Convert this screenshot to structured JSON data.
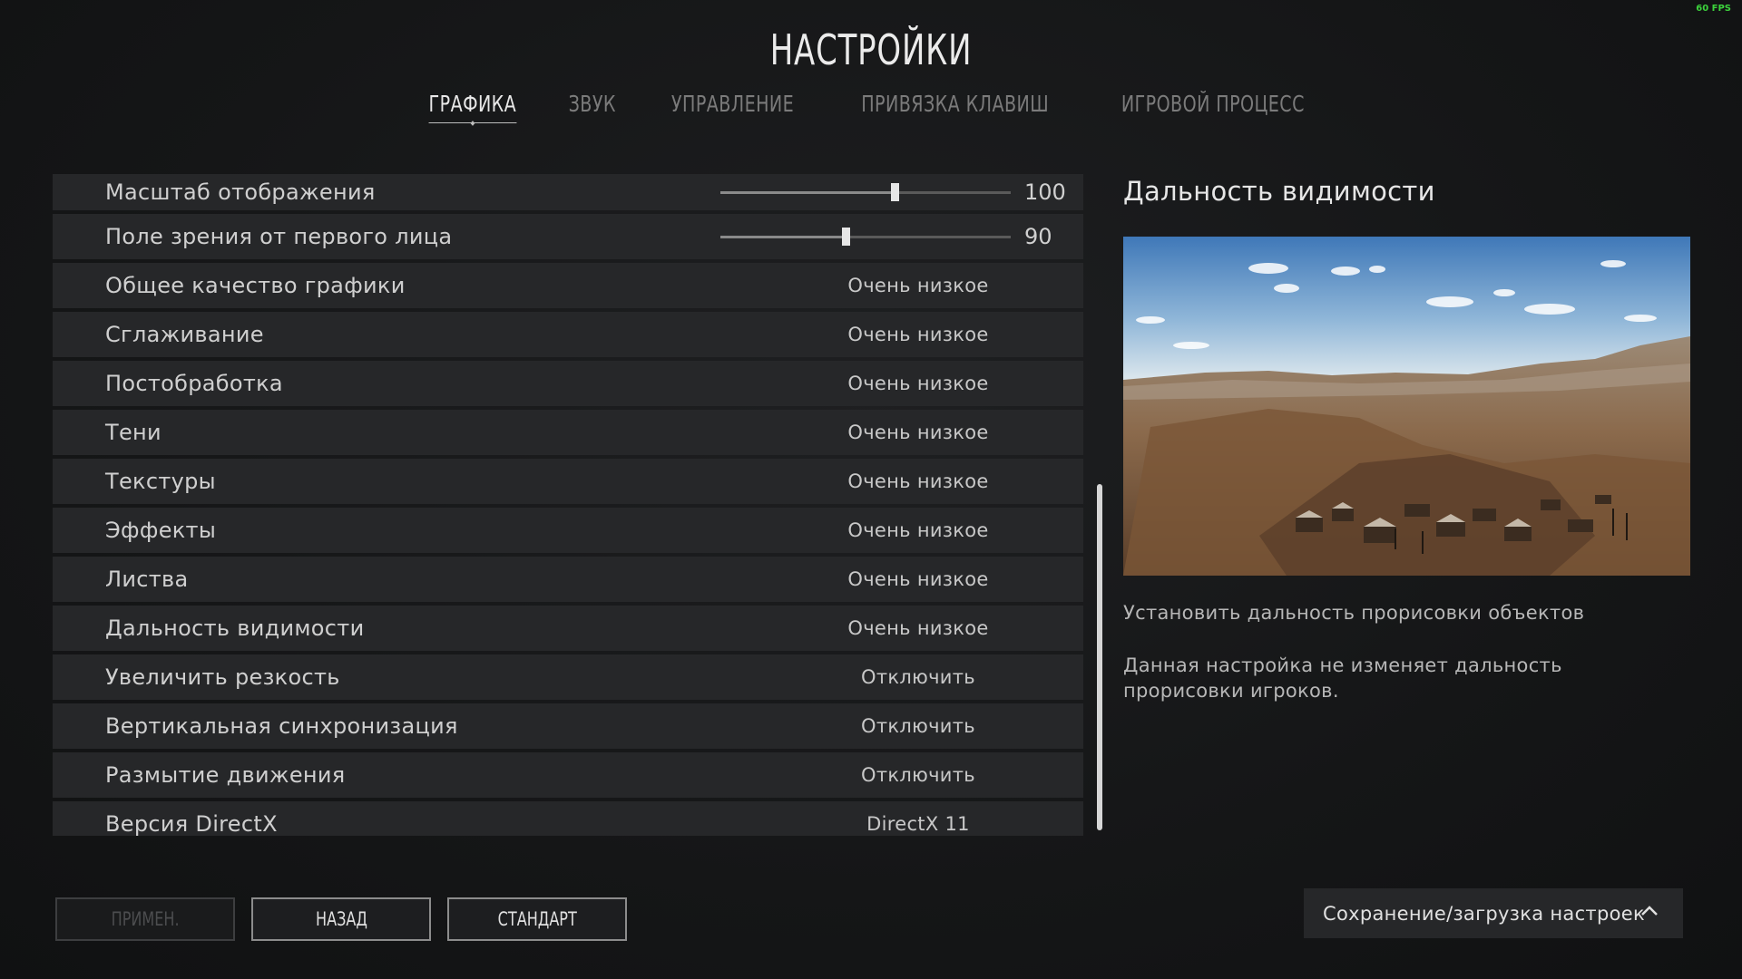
{
  "fps": "60 FPS",
  "title": "НАСТРОЙКИ",
  "tabs": [
    {
      "label": "ГРАФИКА",
      "active": true
    },
    {
      "label": "ЗВУК",
      "active": false
    },
    {
      "label": "УПРАВЛЕНИЕ",
      "active": false
    },
    {
      "label": "ПРИВЯЗКА КЛАВИШ",
      "active": false
    },
    {
      "label": "ИГРОВОЙ ПРОЦЕСС",
      "active": false
    }
  ],
  "settings": [
    {
      "label": "Масштаб отображения",
      "slider_value": "100",
      "slider_fraction": 0.6
    },
    {
      "label": "Поле зрения от первого лица",
      "slider_value": "90",
      "slider_fraction": 0.43
    },
    {
      "label": "Общее качество графики",
      "value": "Очень низкое"
    },
    {
      "label": "Сглаживание",
      "value": "Очень низкое"
    },
    {
      "label": "Постобработка",
      "value": "Очень низкое"
    },
    {
      "label": "Тени",
      "value": "Очень низкое"
    },
    {
      "label": "Текстуры",
      "value": "Очень низкое"
    },
    {
      "label": "Эффекты",
      "value": "Очень низкое"
    },
    {
      "label": "Листва",
      "value": "Очень низкое"
    },
    {
      "label": "Дальность видимости",
      "value": "Очень низкое"
    },
    {
      "label": "Увеличить резкость",
      "value": "Отключить"
    },
    {
      "label": "Вертикальная синхронизация",
      "value": "Отключить"
    },
    {
      "label": "Размытие движения",
      "value": "Отключить"
    },
    {
      "label": "Версия DirectX",
      "value": "DirectX 11"
    }
  ],
  "detail": {
    "title": "Дальность видимости",
    "description": "Установить дальность прорисовки объектов",
    "note": "Данная настройка не изменяет дальность прорисовки игроков."
  },
  "buttons": {
    "apply": "ПРИМЕН.",
    "back": "НАЗАД",
    "default": "СТАНДАРТ"
  },
  "save_load": {
    "label": "Сохранение/загрузка настроек",
    "icon": "chevron-up-icon"
  },
  "colors": {
    "background": "#151617",
    "row": "#262729",
    "fps": "#3cd23c"
  }
}
